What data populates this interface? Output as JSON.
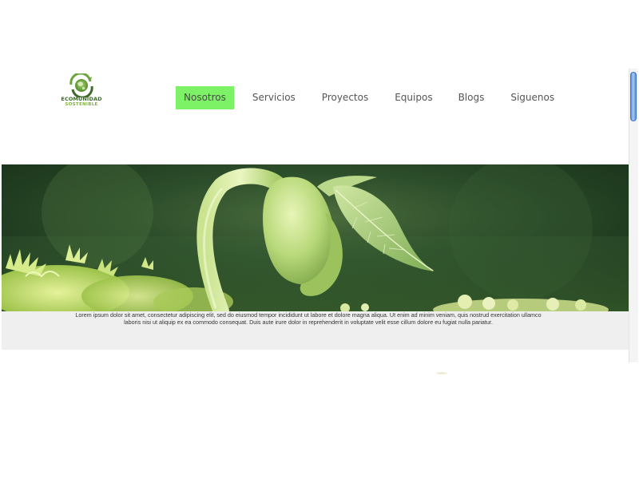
{
  "logo": {
    "title": "ECOMUNIDAD",
    "subtitle": "SOSTENIBLE",
    "icon": "globe-leaf-icon",
    "colors": {
      "dark_green": "#3e6a2a",
      "light_green": "#7fb33a"
    }
  },
  "nav": {
    "items": [
      {
        "label": "Nosotros",
        "active": true
      },
      {
        "label": "Servicios",
        "active": false
      },
      {
        "label": "Proyectos",
        "active": false
      },
      {
        "label": "Equipos",
        "active": false
      },
      {
        "label": "Blogs",
        "active": false
      },
      {
        "label": "Siguenos",
        "active": false
      }
    ],
    "active_color": "#7ef266"
  },
  "hero": {
    "image": "bean-sprout-photo"
  },
  "caption": {
    "text": "Lorem ipsum dolor sit amet, consectetur adipiscing elit, sed do eiusmod tempor incididunt ut labore et dolore magna aliqua. Ut enim ad minim veniam, quis nostrud exercitation ullamco laboris nisi ut aliquip ex ea commodo consequat. Duis aute irure dolor in reprehenderit in voluptate velit esse cillum dolore eu fugiat nulla pariatur."
  }
}
